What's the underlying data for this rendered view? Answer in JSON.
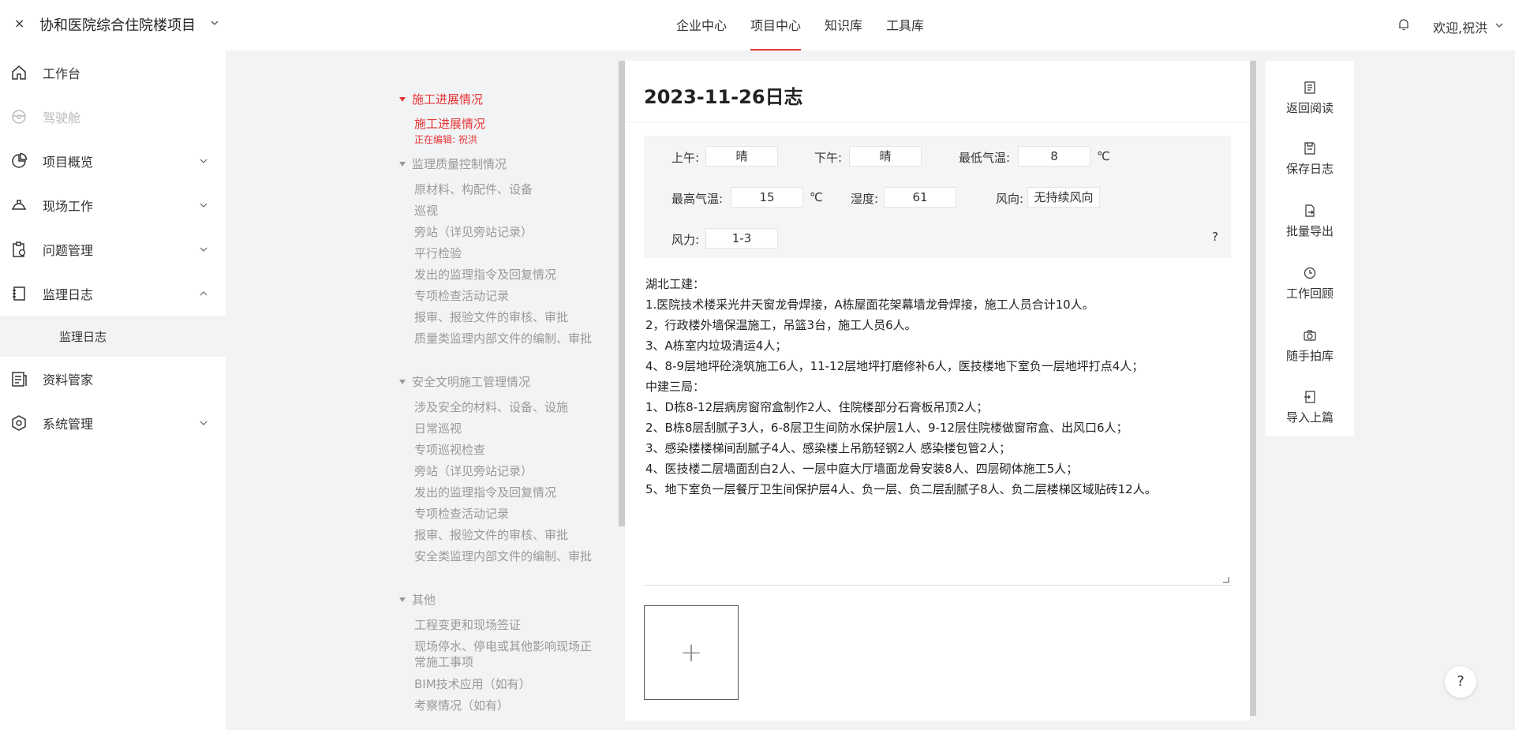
{
  "header": {
    "close_glyph": "×",
    "project_title": "协和医院综合住院楼项目",
    "nav": [
      "企业中心",
      "项目中心",
      "知识库",
      "工具库"
    ],
    "active_nav": "项目中心",
    "welcome": "欢迎,祝洪"
  },
  "sidebar": {
    "items": [
      {
        "label": "工作台",
        "icon": "home-icon"
      },
      {
        "label": "驾驶舱",
        "icon": "dashboard-icon",
        "disabled": true
      },
      {
        "label": "项目概览",
        "icon": "pie-chart-icon"
      },
      {
        "label": "现场工作",
        "icon": "helmet-icon"
      },
      {
        "label": "问题管理",
        "icon": "clipboard-icon"
      },
      {
        "label": "监理日志",
        "icon": "book-icon",
        "expanded": true
      },
      {
        "label": "资料管家",
        "icon": "document-icon"
      },
      {
        "label": "系统管理",
        "icon": "settings-icon"
      }
    ],
    "sub_item": "监理日志"
  },
  "outline": {
    "groups": [
      {
        "label": "施工进展情况",
        "active": true
      },
      {
        "label": "监理质量控制情况"
      },
      {
        "label": "安全文明施工管理情况"
      },
      {
        "label": "其他"
      }
    ],
    "editing_note": "正在编辑: 祝洪",
    "items": [
      "施工进展情况",
      "原材料、构配件、设备",
      "巡视",
      "旁站（详见旁站记录）",
      "平行检验",
      "发出的监理指令及回复情况",
      "专项检查活动记录",
      "报审、报验文件的审核、审批",
      "质量类监理内部文件的编制、审批",
      "涉及安全的材料、设备、设施",
      "日常巡视",
      "专项巡视检查",
      "旁站（详见旁站记录）",
      "发出的监理指令及回复情况",
      "专项检查活动记录",
      "报审、报验文件的审核、审批",
      "安全类监理内部文件的编制、审批",
      "工程变更和现场签证",
      "现场停水、停电或其他影响现场正常施工事项",
      "BIM技术应用（如有）",
      "考察情况（如有）"
    ]
  },
  "log": {
    "title": "2023-11-26日志",
    "weather": {
      "am_label": "上午:",
      "am": "晴",
      "pm_label": "下午:",
      "pm": "晴",
      "min_label": "最低气温:",
      "min": "8",
      "max_label": "最高气温:",
      "max": "15",
      "unit": "℃",
      "humidity_label": "湿度:",
      "humidity": "61",
      "wind_dir_label": "风向:",
      "wind_dir": "无持续风向",
      "wind_force_label": "风力:",
      "wind_force": "1-3",
      "help": "?"
    },
    "lines": [
      "湖北工建：",
      "1.医院技术楼采光井天窗龙骨焊接，A栋屋面花架幕墙龙骨焊接，施工人员合计10人。",
      "2，行政楼外墙保温施工，吊篮3台，施工人员6人。",
      "3、A栋室内垃圾清运4人；",
      "4、8-9层地坪砼浇筑施工6人，11-12层地坪打磨修补6人，医技楼地下室负一层地坪打点4人；",
      "中建三局：",
      "1、D栋8-12层病房窗帘盒制作2人、住院楼部分石膏板吊顶2人；",
      "2、B栋8层刮腻子3人，6-8层卫生间防水保护层1人、9-12层住院楼做窗帘盒、出风口6人；",
      "3、感染楼楼梯间刮腻子4人、感染楼上吊筋轻钢2人 感染楼包管2人；",
      "4、医技楼二层墙面刮白2人、一层中庭大厅墙面龙骨安装8人、四层砌体施工5人；",
      "5、地下室负一层餐厅卫生间保护层4人、负一层、负二层刮腻子8人、负二层楼梯区域贴砖12人。"
    ],
    "upload_glyph": "+"
  },
  "tools": [
    {
      "label": "返回阅读",
      "icon": "document-icon"
    },
    {
      "label": "保存日志",
      "icon": "save-icon"
    },
    {
      "label": "批量导出",
      "icon": "export-icon"
    },
    {
      "label": "工作回顾",
      "icon": "history-icon"
    },
    {
      "label": "随手拍库",
      "icon": "camera-icon"
    },
    {
      "label": "导入上篇",
      "icon": "import-icon"
    }
  ],
  "help_glyph": "?",
  "colors": {
    "accent": "#e63434",
    "muted": "#999999",
    "panel": "#f5f5f5",
    "background": "#f2f3f5"
  }
}
